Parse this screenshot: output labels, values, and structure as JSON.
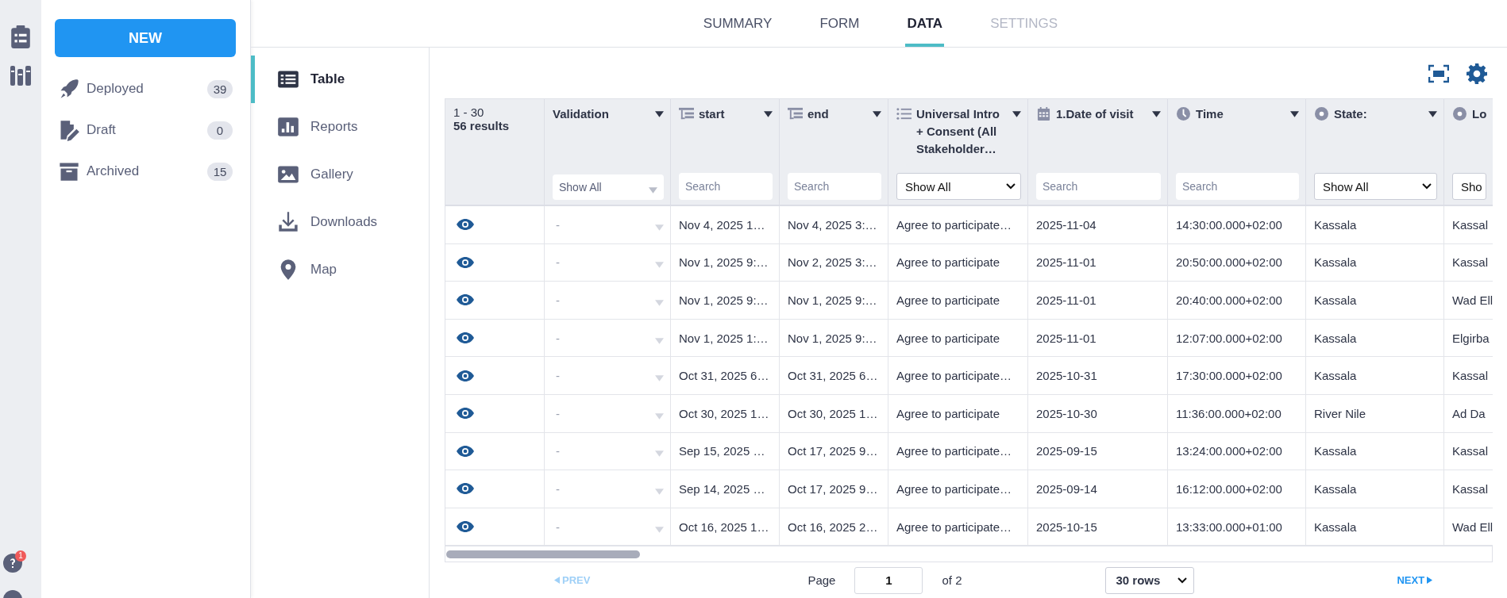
{
  "rail": {
    "help_badge": "1"
  },
  "sidebar": {
    "new_button": "NEW",
    "items": [
      {
        "kind": "deployed",
        "label": "Deployed",
        "count": "39"
      },
      {
        "kind": "draft",
        "label": "Draft",
        "count": "0"
      },
      {
        "kind": "archived",
        "label": "Archived",
        "count": "15"
      }
    ]
  },
  "tabs": [
    {
      "label": "SUMMARY",
      "selected": false,
      "disabled": false
    },
    {
      "label": "FORM",
      "selected": false,
      "disabled": false
    },
    {
      "label": "DATA",
      "selected": true,
      "disabled": false
    },
    {
      "label": "SETTINGS",
      "selected": false,
      "disabled": true
    }
  ],
  "subnav": [
    {
      "kind": "table",
      "label": "Table",
      "selected": true
    },
    {
      "kind": "reports",
      "label": "Reports",
      "selected": false
    },
    {
      "kind": "gallery",
      "label": "Gallery",
      "selected": false
    },
    {
      "kind": "downloads",
      "label": "Downloads",
      "selected": false
    },
    {
      "kind": "map",
      "label": "Map",
      "selected": false
    }
  ],
  "table": {
    "range": "1 - 30",
    "results": "56 results",
    "columns": [
      {
        "kind": "validation",
        "label": "Validation",
        "filter": {
          "kind": "dropdown",
          "value": "Show All"
        }
      },
      {
        "kind": "text",
        "label": "start",
        "filter": {
          "kind": "search",
          "placeholder": "Search"
        }
      },
      {
        "kind": "text",
        "label": "end",
        "filter": {
          "kind": "search",
          "placeholder": "Search"
        }
      },
      {
        "kind": "list",
        "label": "Universal Intro + Consent (All Stakeholder…",
        "filter": {
          "kind": "select",
          "value": "Show All"
        }
      },
      {
        "kind": "date",
        "label": "1.Date of visit",
        "filter": {
          "kind": "search",
          "placeholder": "Search"
        }
      },
      {
        "kind": "time",
        "label": "Time",
        "filter": {
          "kind": "search",
          "placeholder": "Search"
        }
      },
      {
        "kind": "radio",
        "label": "State:",
        "filter": {
          "kind": "select",
          "value": "Show All"
        }
      },
      {
        "kind": "radio",
        "label": "Lo",
        "filter": {
          "kind": "select",
          "value": "Sho"
        }
      }
    ],
    "rows": [
      {
        "cells": [
          "-",
          "Nov 4, 2025 1…",
          "Nov 4, 2025 3:…",
          "Agree to participate…",
          "2025-11-04",
          "14:30:00.000+02:00",
          "Kassala",
          "Kassal"
        ]
      },
      {
        "cells": [
          "-",
          "Nov 1, 2025 9:…",
          "Nov 2, 2025 3:…",
          "Agree to participate",
          "2025-11-01",
          "20:50:00.000+02:00",
          "Kassala",
          "Kassal"
        ]
      },
      {
        "cells": [
          "-",
          "Nov 1, 2025 9:…",
          "Nov 1, 2025 9:…",
          "Agree to participate",
          "2025-11-01",
          "20:40:00.000+02:00",
          "Kassala",
          "Wad Ell"
        ]
      },
      {
        "cells": [
          "-",
          "Nov 1, 2025 1:…",
          "Nov 1, 2025 9:…",
          "Agree to participate",
          "2025-11-01",
          "12:07:00.000+02:00",
          "Kassala",
          "Elgirba"
        ]
      },
      {
        "cells": [
          "-",
          "Oct 31, 2025 6…",
          "Oct 31, 2025 6…",
          "Agree to participate…",
          "2025-10-31",
          "17:30:00.000+02:00",
          "Kassala",
          "Kassal"
        ]
      },
      {
        "cells": [
          "-",
          "Oct 30, 2025 1…",
          "Oct 30, 2025 1…",
          "Agree to participate",
          "2025-10-30",
          "11:36:00.000+02:00",
          "River Nile",
          "Ad Da"
        ]
      },
      {
        "cells": [
          "-",
          "Sep 15, 2025 …",
          "Oct 17, 2025 9…",
          "Agree to participate…",
          "2025-09-15",
          "13:24:00.000+02:00",
          "Kassala",
          "Kassal"
        ]
      },
      {
        "cells": [
          "-",
          "Sep 14, 2025 …",
          "Oct 17, 2025 9…",
          "Agree to participate…",
          "2025-09-14",
          "16:12:00.000+02:00",
          "Kassala",
          "Kassal"
        ]
      },
      {
        "cells": [
          "-",
          "Oct 16, 2025 1…",
          "Oct 16, 2025 2…",
          "Agree to participate…",
          "2025-10-15",
          "13:33:00.000+01:00",
          "Kassala",
          "Wad Ell"
        ]
      }
    ]
  },
  "pagination": {
    "prev": {
      "label": "PREV",
      "disabled": true
    },
    "page_label": "Page",
    "page": "1",
    "of": "of 2",
    "rows": "30 rows",
    "next": {
      "label": "NEXT",
      "disabled": false
    }
  }
}
